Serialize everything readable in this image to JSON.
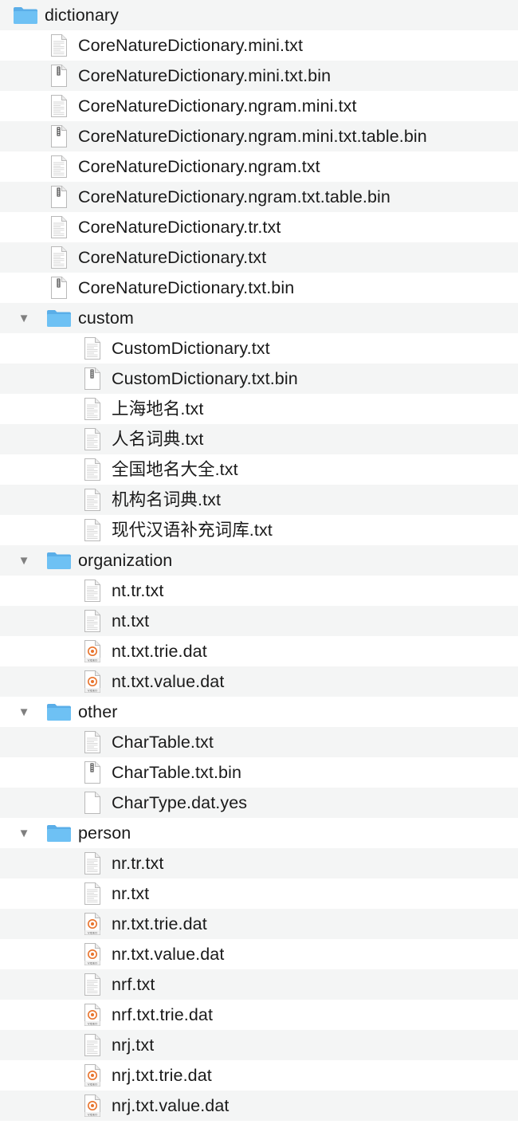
{
  "root": {
    "name": "dictionary",
    "type": "folder"
  },
  "rows": [
    {
      "level": 1,
      "type": "txt",
      "name": "CoreNatureDictionary.mini.txt"
    },
    {
      "level": 1,
      "type": "bin",
      "name": "CoreNatureDictionary.mini.txt.bin"
    },
    {
      "level": 1,
      "type": "txt",
      "name": "CoreNatureDictionary.ngram.mini.txt"
    },
    {
      "level": 1,
      "type": "bin",
      "name": "CoreNatureDictionary.ngram.mini.txt.table.bin"
    },
    {
      "level": 1,
      "type": "txt",
      "name": "CoreNatureDictionary.ngram.txt"
    },
    {
      "level": 1,
      "type": "bin",
      "name": "CoreNatureDictionary.ngram.txt.table.bin"
    },
    {
      "level": 1,
      "type": "txt",
      "name": "CoreNatureDictionary.tr.txt"
    },
    {
      "level": 1,
      "type": "txt",
      "name": "CoreNatureDictionary.txt"
    },
    {
      "level": 1,
      "type": "bin",
      "name": "CoreNatureDictionary.txt.bin"
    },
    {
      "level": 1,
      "type": "folder",
      "name": "custom",
      "expanded": true
    },
    {
      "level": 2,
      "type": "txt",
      "name": "CustomDictionary.txt"
    },
    {
      "level": 2,
      "type": "bin",
      "name": "CustomDictionary.txt.bin"
    },
    {
      "level": 2,
      "type": "txt",
      "name": "上海地名.txt"
    },
    {
      "level": 2,
      "type": "txt",
      "name": "人名词典.txt"
    },
    {
      "level": 2,
      "type": "txt",
      "name": "全国地名大全.txt"
    },
    {
      "level": 2,
      "type": "txt",
      "name": "机构名词典.txt"
    },
    {
      "level": 2,
      "type": "txt",
      "name": "现代汉语补充词库.txt"
    },
    {
      "level": 1,
      "type": "folder",
      "name": "organization",
      "expanded": true
    },
    {
      "level": 2,
      "type": "txt",
      "name": "nt.tr.txt"
    },
    {
      "level": 2,
      "type": "txt",
      "name": "nt.txt"
    },
    {
      "level": 2,
      "type": "video",
      "name": "nt.txt.trie.dat"
    },
    {
      "level": 2,
      "type": "video",
      "name": "nt.txt.value.dat"
    },
    {
      "level": 1,
      "type": "folder",
      "name": "other",
      "expanded": true
    },
    {
      "level": 2,
      "type": "txt",
      "name": "CharTable.txt"
    },
    {
      "level": 2,
      "type": "bin",
      "name": "CharTable.txt.bin"
    },
    {
      "level": 2,
      "type": "blank",
      "name": "CharType.dat.yes"
    },
    {
      "level": 1,
      "type": "folder",
      "name": "person",
      "expanded": true
    },
    {
      "level": 2,
      "type": "txt",
      "name": "nr.tr.txt"
    },
    {
      "level": 2,
      "type": "txt",
      "name": "nr.txt"
    },
    {
      "level": 2,
      "type": "video",
      "name": "nr.txt.trie.dat"
    },
    {
      "level": 2,
      "type": "video",
      "name": "nr.txt.value.dat"
    },
    {
      "level": 2,
      "type": "txt",
      "name": "nrf.txt"
    },
    {
      "level": 2,
      "type": "video",
      "name": "nrf.txt.trie.dat"
    },
    {
      "level": 2,
      "type": "txt",
      "name": "nrj.txt"
    },
    {
      "level": 2,
      "type": "video",
      "name": "nrj.txt.trie.dat"
    },
    {
      "level": 2,
      "type": "video",
      "name": "nrj.txt.value.dat"
    }
  ],
  "icon_names": {
    "folder": "folder-icon",
    "txt": "text-document-icon",
    "bin": "binary-document-icon",
    "video": "video-document-icon",
    "blank": "blank-document-icon",
    "disclosure": "disclosure-triangle-down-icon"
  },
  "icon_text": {
    "video": "VIDEO"
  },
  "colors": {
    "folder": "#6ec1f4",
    "folder_tab": "#5aaee8",
    "stripe": "#f4f5f5",
    "text": "#1a1a1a",
    "disclosure": "#7f7f7f",
    "video_accent": "#e8732c"
  }
}
